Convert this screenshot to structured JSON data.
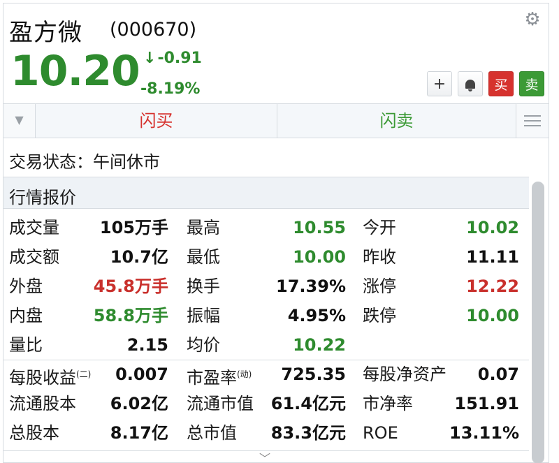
{
  "header": {
    "name": "盈方微",
    "code": "(000670)",
    "price": "10.20",
    "change_arrow": "↓",
    "change": "-0.91",
    "change_pct": "-8.19%"
  },
  "buttons": {
    "add": "+",
    "buy": "买",
    "sell": "卖"
  },
  "flash": {
    "buy": "闪买",
    "sell": "闪卖"
  },
  "status": {
    "text": "交易状态：午间休市"
  },
  "section": {
    "title": "行情报价"
  },
  "quotes": [
    [
      {
        "label": "成交量",
        "value": "105万手",
        "color": "dark"
      },
      {
        "label": "最高",
        "value": "10.55",
        "color": "green"
      },
      {
        "label": "今开",
        "value": "10.02",
        "color": "green"
      }
    ],
    [
      {
        "label": "成交额",
        "value": "10.7亿",
        "color": "dark"
      },
      {
        "label": "最低",
        "value": "10.00",
        "color": "green"
      },
      {
        "label": "昨收",
        "value": "11.11",
        "color": "dark"
      }
    ],
    [
      {
        "label": "外盘",
        "value": "45.8万手",
        "color": "red"
      },
      {
        "label": "换手",
        "value": "17.39%",
        "color": "dark"
      },
      {
        "label": "涨停",
        "value": "12.22",
        "color": "red"
      }
    ],
    [
      {
        "label": "内盘",
        "value": "58.8万手",
        "color": "green"
      },
      {
        "label": "振幅",
        "value": "4.95%",
        "color": "dark"
      },
      {
        "label": "跌停",
        "value": "10.00",
        "color": "green"
      }
    ],
    [
      {
        "label": "量比",
        "value": "2.15",
        "color": "dark"
      },
      {
        "label": "均价",
        "value": "10.22",
        "color": "green"
      },
      {
        "label": "",
        "value": "",
        "color": "dark"
      }
    ]
  ],
  "fundamentals": [
    [
      {
        "label": "每股收益",
        "sup": "(二)",
        "value": "0.007"
      },
      {
        "label": "市盈率",
        "sup": "(动)",
        "value": "725.35"
      },
      {
        "label": "每股净资产",
        "sup": "",
        "value": "0.07"
      }
    ],
    [
      {
        "label": "流通股本",
        "sup": "",
        "value": "6.02亿"
      },
      {
        "label": "流通市值",
        "sup": "",
        "value": "61.4亿元"
      },
      {
        "label": "市净率",
        "sup": "",
        "value": "151.91"
      }
    ],
    [
      {
        "label": "总股本",
        "sup": "",
        "value": "8.17亿"
      },
      {
        "label": "总市值",
        "sup": "",
        "value": "83.3亿元"
      },
      {
        "label": "ROE",
        "sup": "",
        "value": "13.11%"
      }
    ]
  ],
  "colors": {
    "up": "#c9302c",
    "down": "#2e8b2e"
  },
  "icons": {
    "settings": "gear-icon",
    "collapse": "double-chevron-down-icon",
    "menu": "hamburger-icon",
    "more": "chevron-down-icon",
    "alert": "bell-icon",
    "down_arrow": "arrow-down-icon"
  }
}
